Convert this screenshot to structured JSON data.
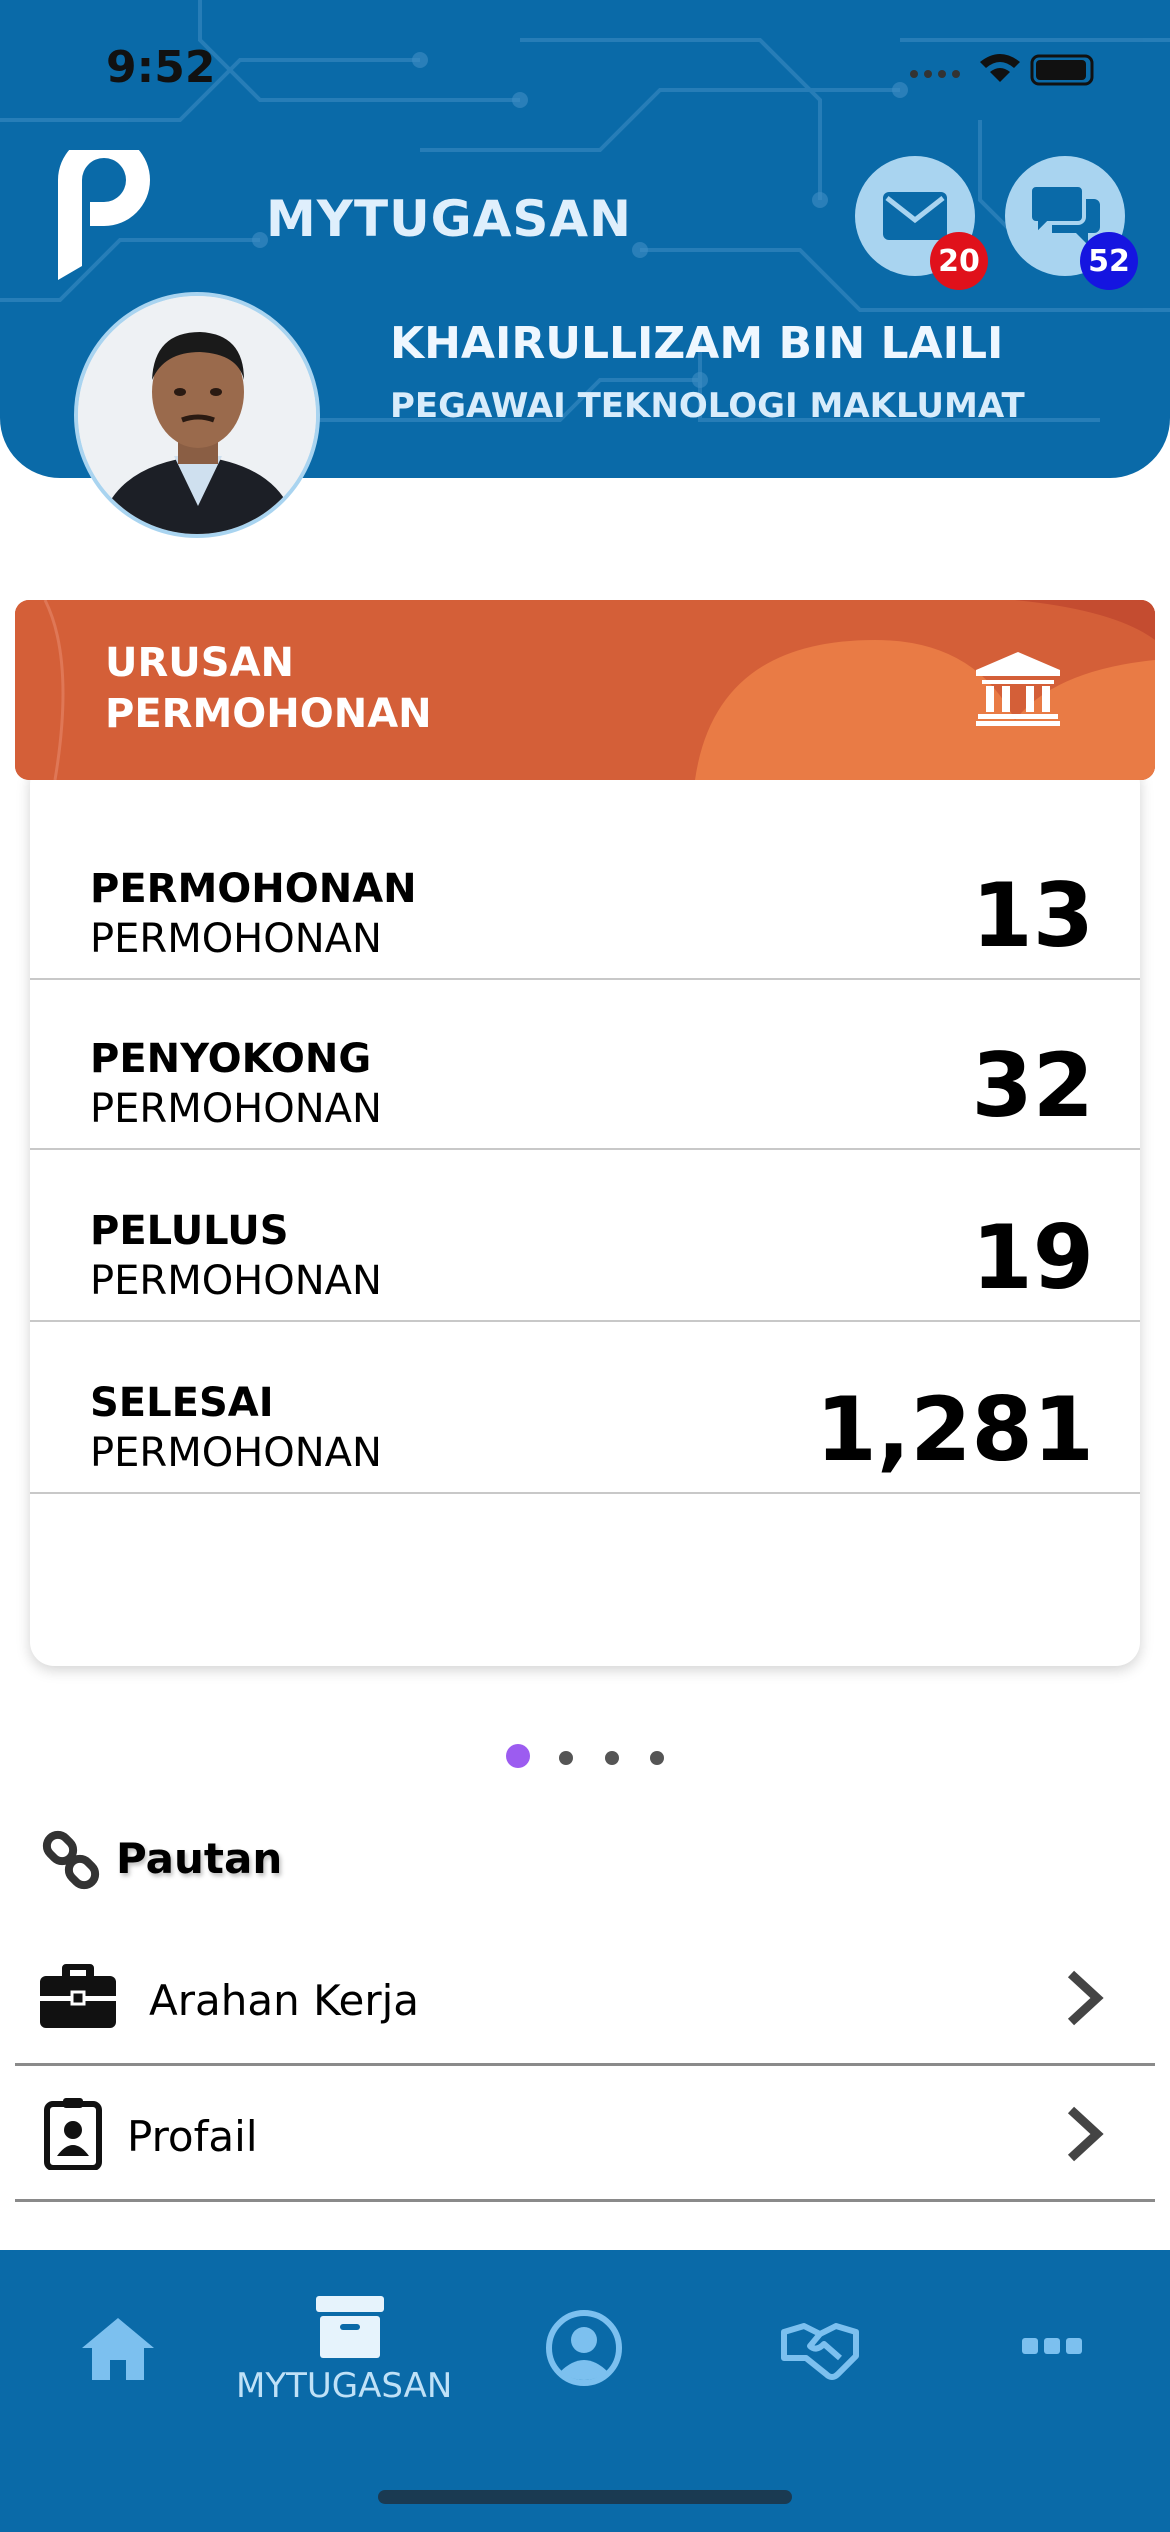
{
  "status_bar": {
    "time": "9:52"
  },
  "header": {
    "app_title": "MYTUGASAN",
    "mail_badge": "20",
    "chat_badge": "52",
    "user_name": "KHAIRULLIZAM BIN LAILI",
    "user_role": "PEGAWAI TEKNOLOGI MAKLUMAT"
  },
  "card": {
    "title_line1": "URUSAN",
    "title_line2": "PERMOHONAN",
    "rows": [
      {
        "label": "PERMOHONAN",
        "sublabel": "PERMOHONAN",
        "value": "13"
      },
      {
        "label": "PENYOKONG",
        "sublabel": "PERMOHONAN",
        "value": "32"
      },
      {
        "label": "PELULUS",
        "sublabel": "PERMOHONAN",
        "value": "19"
      },
      {
        "label": "SELESAI",
        "sublabel": "PERMOHONAN",
        "value": "1,281"
      }
    ]
  },
  "pager": {
    "pages": 4,
    "active": 1
  },
  "links": {
    "heading": "Pautan",
    "items": [
      {
        "label": "Arahan Kerja",
        "icon": "briefcase-icon"
      },
      {
        "label": "Profail",
        "icon": "id-badge-icon"
      }
    ]
  },
  "tabbar": {
    "items": [
      {
        "icon": "home-icon"
      },
      {
        "icon": "archive-icon",
        "label": "MYTUGASAN"
      },
      {
        "icon": "user-circle-icon"
      },
      {
        "icon": "handshake-icon"
      },
      {
        "icon": "more-icon"
      }
    ]
  },
  "colors": {
    "header_blue": "#0a6aa8",
    "banner_orange": "#d45f38",
    "badge_red": "#e0111b",
    "badge_blue": "#1515e0",
    "pager_active": "#9c5cf0"
  }
}
